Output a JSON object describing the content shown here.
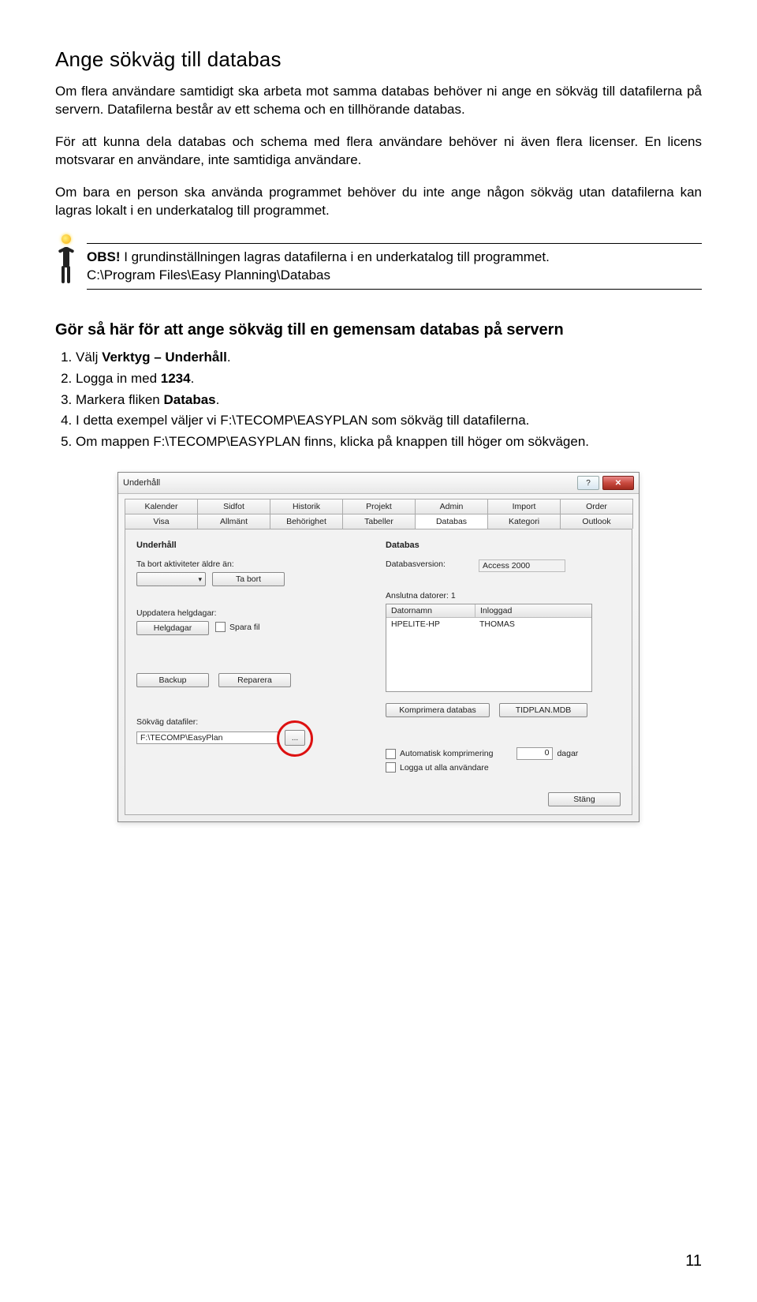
{
  "title": "Ange sökväg till databas",
  "p1": "Om flera användare samtidigt ska arbeta mot samma databas behöver ni ange en sökväg till datafilerna på servern. Datafilerna består av ett schema och en tillhörande databas.",
  "p2": "För att kunna dela databas och schema med flera användare behöver ni även flera licenser. En licens motsvarar en användare, inte samtidiga användare.",
  "p3": "Om bara en person ska använda programmet behöver du inte ange någon sökväg utan datafilerna kan lagras lokalt i en underkatalog till programmet.",
  "obs_label": "OBS!",
  "obs_text": " I grundinställningen lagras datafilerna i en underkatalog till programmet.",
  "obs_path": "C:\\Program Files\\Easy Planning\\Databas",
  "subtitle": "Gör så här för att ange sökväg till en gemensam databas på servern",
  "steps": {
    "s1a": "Välj ",
    "s1b": "Verktyg – Underhåll",
    "s1c": ".",
    "s2a": "Logga in med ",
    "s2b": "1234",
    "s2c": ".",
    "s3a": "Markera fliken ",
    "s3b": "Databas",
    "s3c": ".",
    "s4": "I detta exempel väljer vi F:\\TECOMP\\EASYPLAN som sökväg till datafilerna.",
    "s5": "Om mappen F:\\TECOMP\\EASYPLAN finns, klicka på knappen till höger om sökvägen."
  },
  "dialog": {
    "title": "Underhåll",
    "tabs_row1": [
      "Kalender",
      "Sidfot",
      "Historik",
      "Projekt",
      "Admin",
      "Import",
      "Order"
    ],
    "tabs_row2": [
      "Visa",
      "Allmänt",
      "Behörighet",
      "Tabeller",
      "Databas",
      "Kategori",
      "Outlook"
    ],
    "active_tab": "Databas",
    "left": {
      "group": "Underhåll",
      "older_label": "Ta bort aktiviteter äldre än:",
      "remove_btn": "Ta bort",
      "update_label": "Uppdatera helgdagar:",
      "holidays_btn": "Helgdagar",
      "save_file": "Spara fil",
      "backup_btn": "Backup",
      "repair_btn": "Reparera",
      "path_label": "Sökväg datafiler:",
      "path_value": "F:\\TECOMP\\EasyPlan",
      "browse": "..."
    },
    "right": {
      "group": "Databas",
      "dbver_label": "Databasversion:",
      "dbver_value": "Access 2000",
      "connected_label": "Anslutna datorer: 1",
      "col1": "Datornamn",
      "col2": "Inloggad",
      "row_computer": "HPELITE-HP",
      "row_user": "THOMAS",
      "compress_btn": "Komprimera databas",
      "tidplan_btn": "TIDPLAN.MDB",
      "auto_compress": "Automatisk komprimering",
      "days_value": "0",
      "days_label": "dagar",
      "logout_all": "Logga ut alla användare"
    },
    "close_btn": "Stäng",
    "help_glyph": "?",
    "close_glyph": "✕"
  },
  "page_number": "11"
}
